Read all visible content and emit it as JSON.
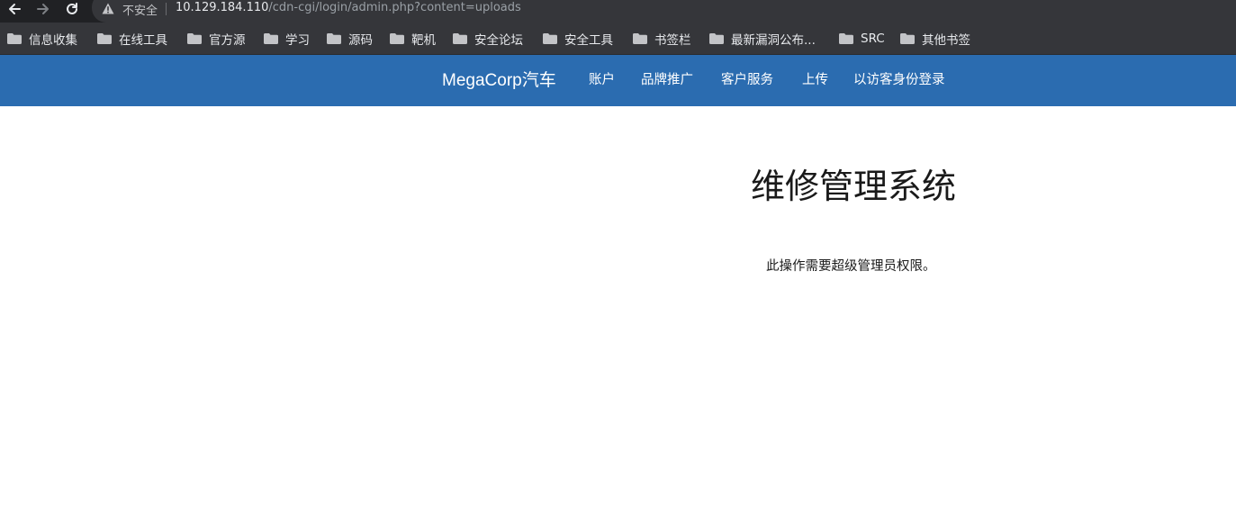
{
  "browser": {
    "nav": {
      "back_icon": "arrow-left-icon",
      "forward_icon": "arrow-right-icon",
      "reload_icon": "reload-icon"
    },
    "omnibox": {
      "security_icon": "warning-triangle-icon",
      "security_label": "不安全",
      "url_host": "10.129.184.110",
      "url_path": "/cdn-cgi/login/admin.php?content=uploads"
    },
    "bookmarks": [
      {
        "label": "信息收集"
      },
      {
        "label": "在线工具"
      },
      {
        "label": "官方源"
      },
      {
        "label": "学习"
      },
      {
        "label": "源码"
      },
      {
        "label": "靶机"
      },
      {
        "label": "安全论坛"
      },
      {
        "label": "安全工具"
      },
      {
        "label": "书签栏"
      },
      {
        "label": "最新漏洞公布..."
      },
      {
        "label": "SRC"
      },
      {
        "label": "其他书签"
      }
    ]
  },
  "site": {
    "brand": "MegaCorp汽车",
    "nav": [
      "账户",
      "品牌推广",
      "客户服务",
      "上传",
      "以访客身份登录"
    ],
    "colors": {
      "navbar": "#2b6cb0"
    }
  },
  "main": {
    "title": "维修管理系统",
    "notice": "此操作需要超级管理员权限。"
  }
}
